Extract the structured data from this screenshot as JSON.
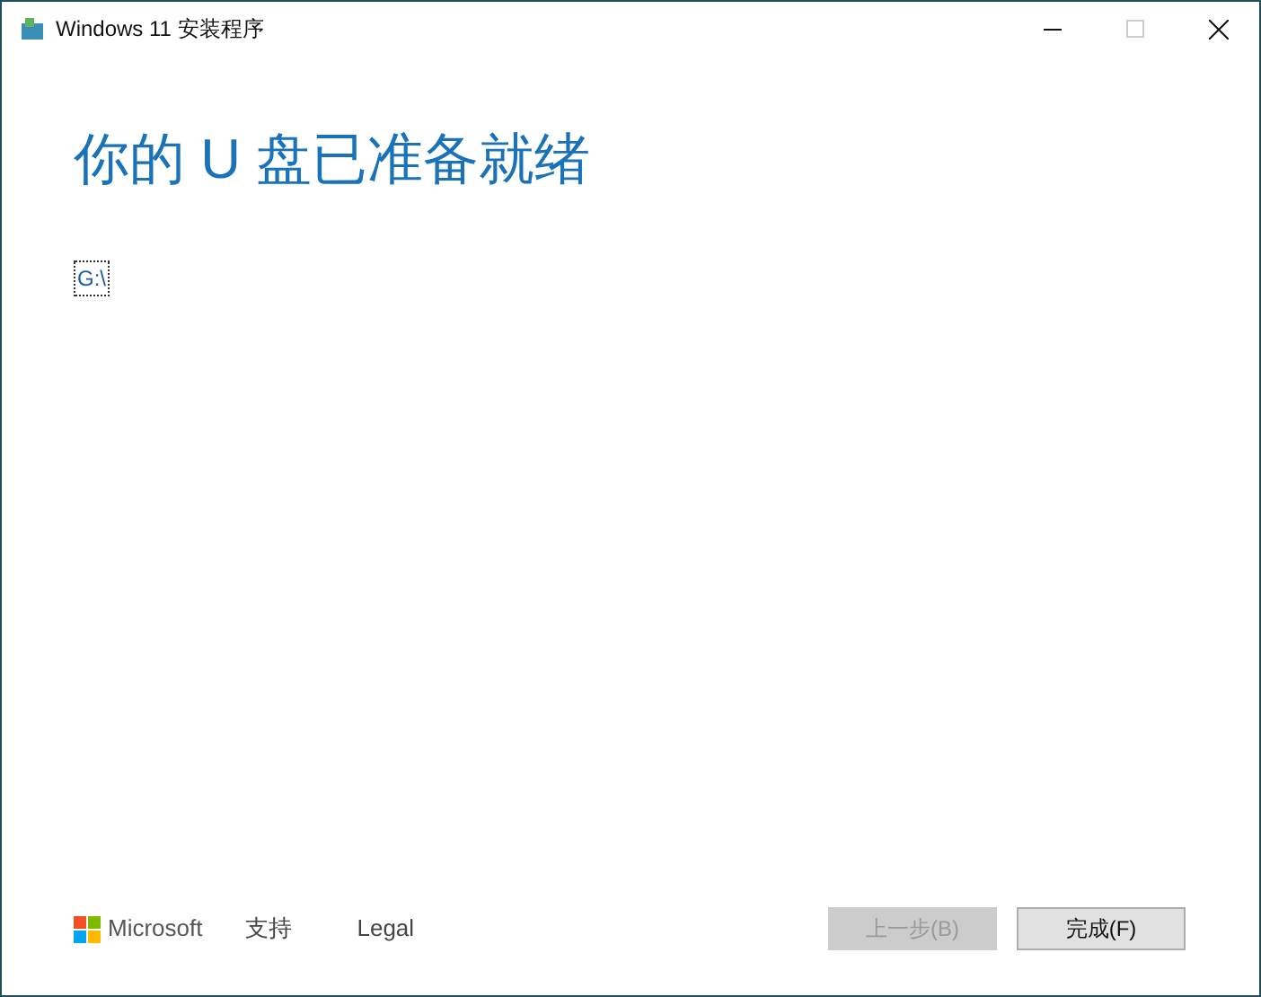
{
  "window": {
    "title": "Windows 11 安装程序"
  },
  "heading": "你的 U 盘已准备就绪",
  "drive": {
    "label": "G:\\",
    "focused": true
  },
  "footer": {
    "brand": "Microsoft",
    "links": [
      "支持",
      "Legal"
    ]
  },
  "buttons": [
    {
      "label": "上一步(B)",
      "disabled": true
    },
    {
      "label": "完成(F)",
      "disabled": false
    }
  ]
}
